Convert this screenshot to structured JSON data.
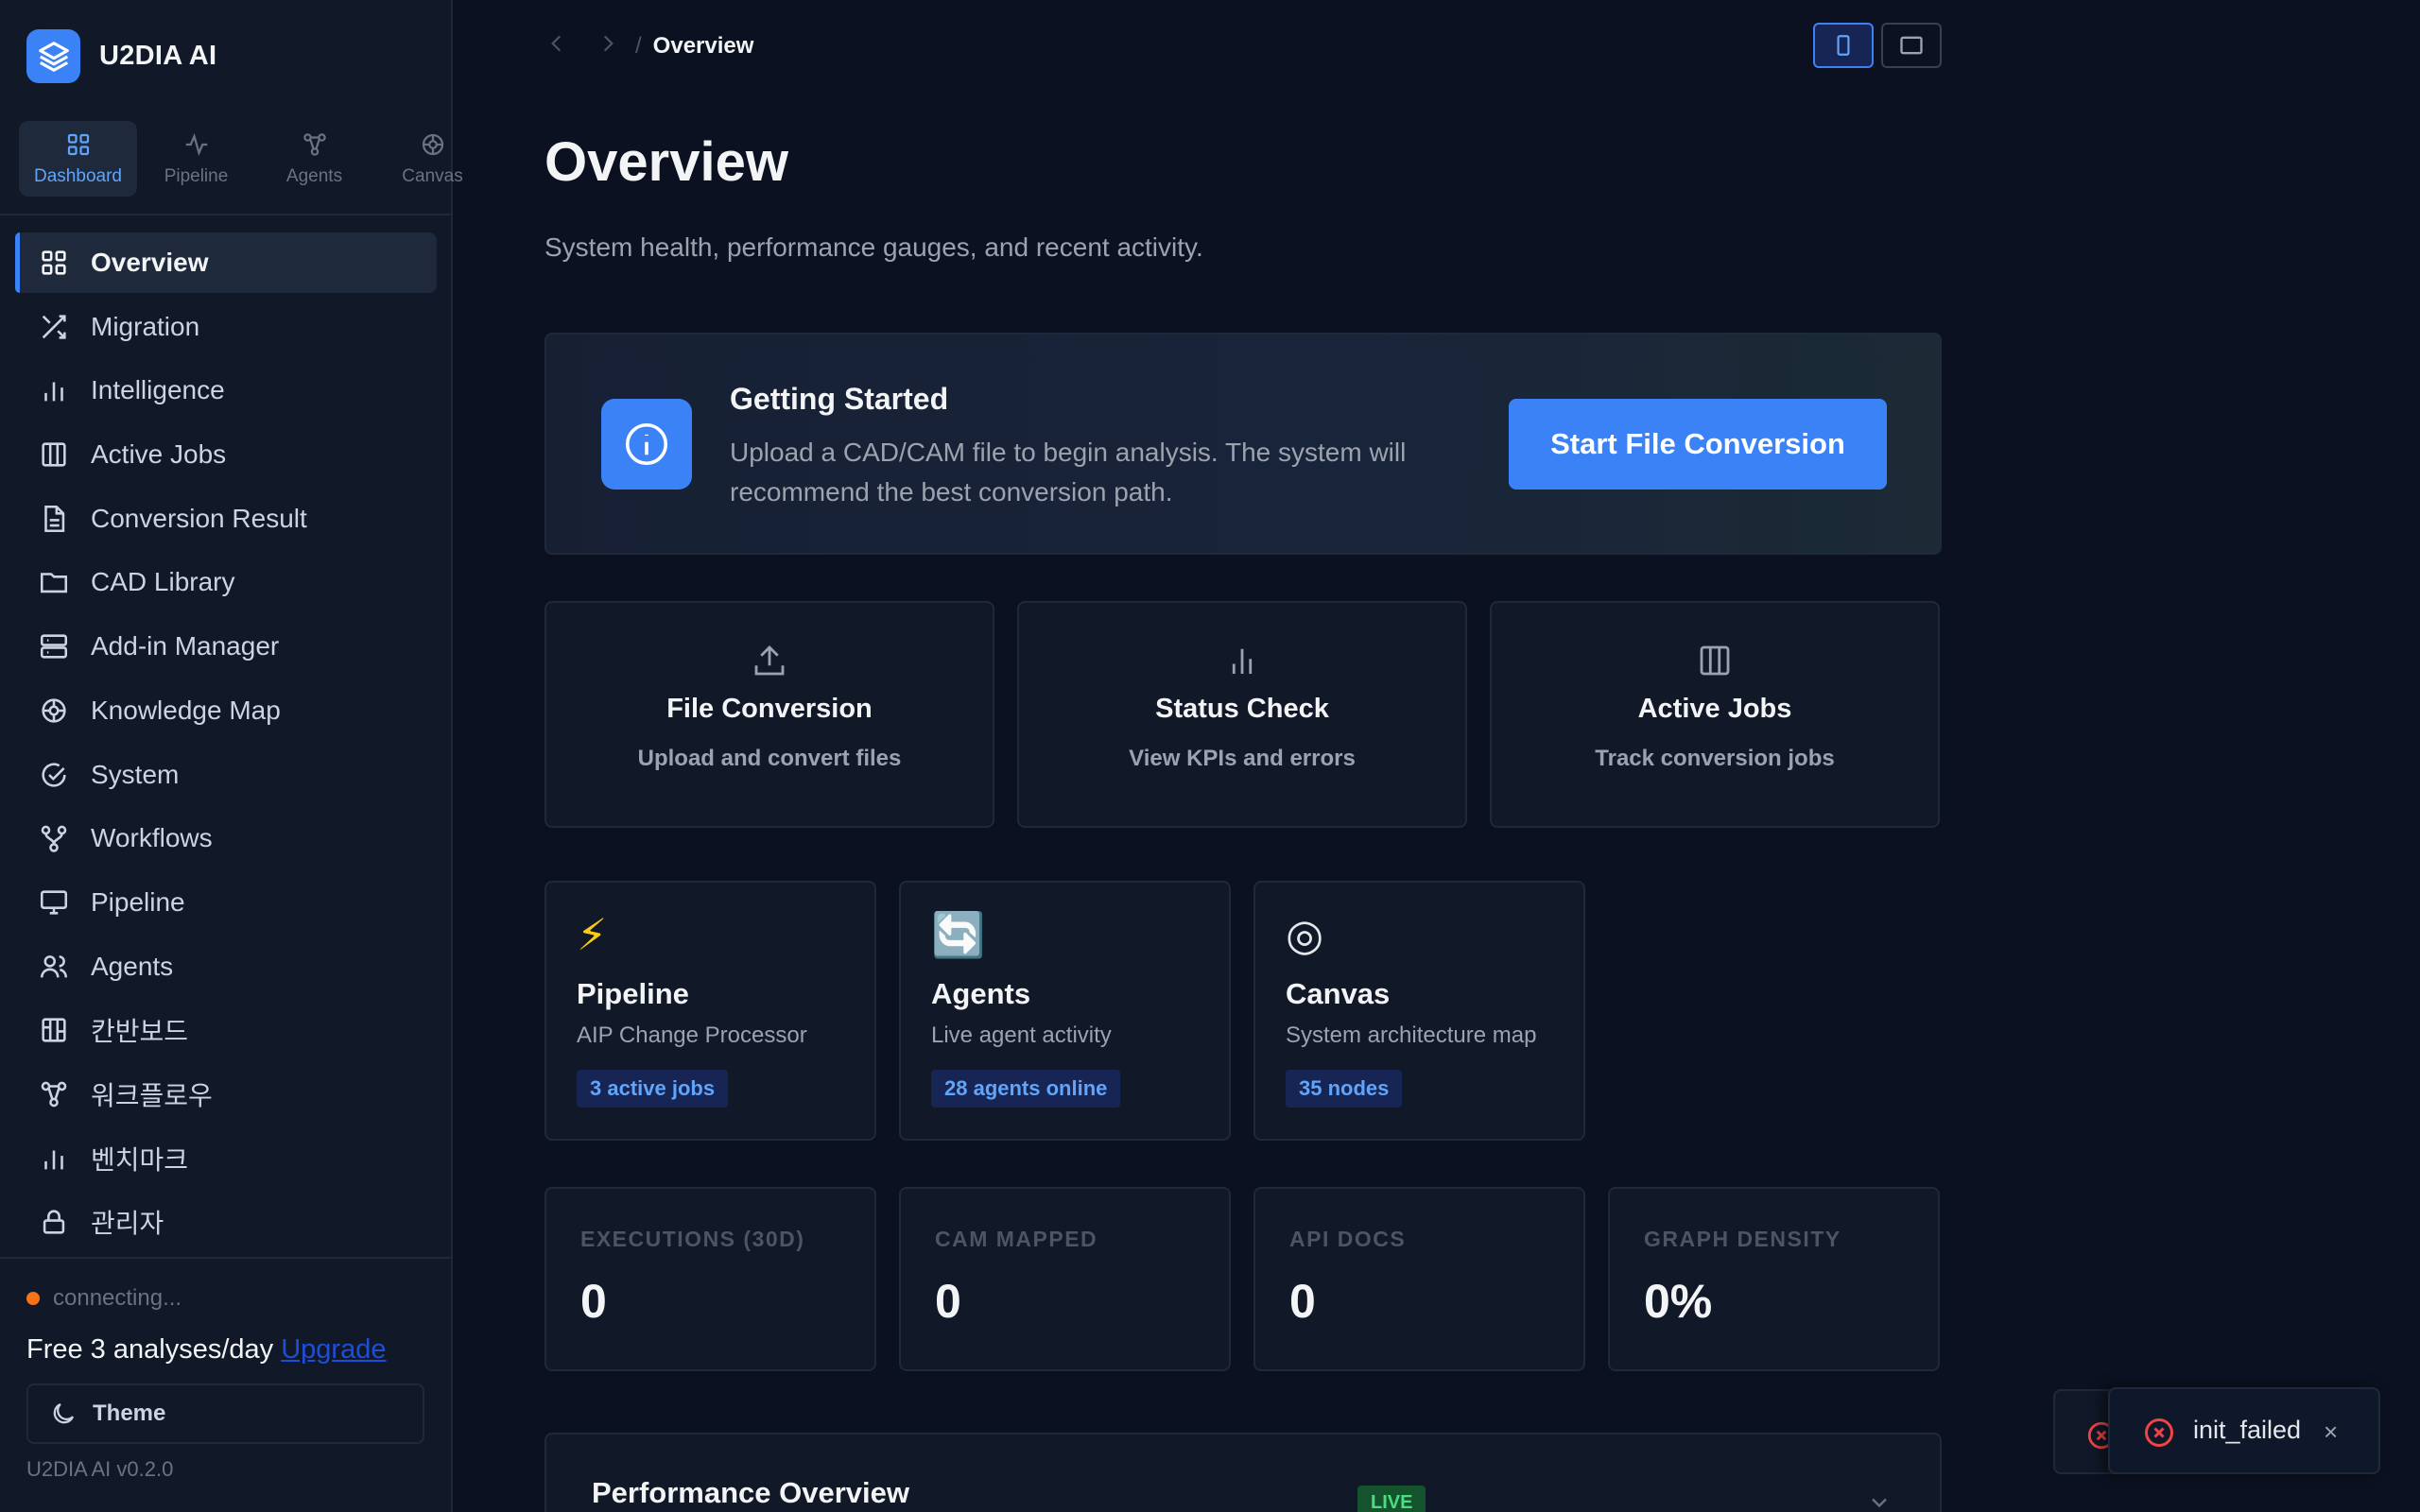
{
  "brand": {
    "name": "U2DIA AI"
  },
  "mode_tabs": [
    {
      "label": "Dashboard",
      "icon": "grid-icon",
      "active": true
    },
    {
      "label": "Pipeline",
      "icon": "activity-icon",
      "active": false
    },
    {
      "label": "Agents",
      "icon": "share-nodes-icon",
      "active": false
    },
    {
      "label": "Canvas",
      "icon": "target-icon",
      "active": false
    }
  ],
  "nav": [
    {
      "label": "Overview",
      "icon": "grid-icon",
      "active": true
    },
    {
      "label": "Migration",
      "icon": "shuffle-icon"
    },
    {
      "label": "Intelligence",
      "icon": "bar-chart-icon"
    },
    {
      "label": "Active Jobs",
      "icon": "columns-icon"
    },
    {
      "label": "Conversion Result",
      "icon": "file-text-icon"
    },
    {
      "label": "CAD Library",
      "icon": "folder-icon"
    },
    {
      "label": "Add-in Manager",
      "icon": "server-icon"
    },
    {
      "label": "Knowledge Map",
      "icon": "target-icon"
    },
    {
      "label": "System",
      "icon": "check-circle-icon"
    },
    {
      "label": "Workflows",
      "icon": "git-branch-icon"
    },
    {
      "label": "Pipeline",
      "icon": "monitor-icon"
    },
    {
      "label": "Agents",
      "icon": "users-icon"
    },
    {
      "label": "칸반보드",
      "icon": "kanban-icon"
    },
    {
      "label": "워크플로우",
      "icon": "share-nodes-icon"
    },
    {
      "label": "벤치마크",
      "icon": "bar-chart-icon"
    },
    {
      "label": "관리자",
      "icon": "lock-icon"
    }
  ],
  "footer": {
    "status": "connecting...",
    "plan_text": "Free 3 analyses/day",
    "upgrade_link": "Upgrade",
    "theme_label": "Theme",
    "version": "U2DIA AI v0.2.0"
  },
  "breadcrumb": {
    "current": "Overview",
    "separator": "/"
  },
  "page": {
    "title": "Overview",
    "subtitle": "System health, performance gauges, and recent activity."
  },
  "getting_started": {
    "title": "Getting Started",
    "description": "Upload a CAD/CAM file to begin analysis. The system will recommend the best conversion path.",
    "button": "Start File Conversion"
  },
  "quick_actions": [
    {
      "title": "File Conversion",
      "subtitle": "Upload and convert files",
      "icon": "upload-icon"
    },
    {
      "title": "Status Check",
      "subtitle": "View KPIs and errors",
      "icon": "bar-chart-icon"
    },
    {
      "title": "Active Jobs",
      "subtitle": "Track conversion jobs",
      "icon": "columns-icon"
    }
  ],
  "modules": [
    {
      "emoji": "⚡",
      "title": "Pipeline",
      "subtitle": "AIP Change Processor",
      "badge": "3 active jobs"
    },
    {
      "emoji": "🔄",
      "title": "Agents",
      "subtitle": "Live agent activity",
      "badge": "28 agents online"
    },
    {
      "emoji": "◎",
      "title": "Canvas",
      "subtitle": "System architecture map",
      "badge": "35 nodes"
    }
  ],
  "kpis": [
    {
      "label": "EXECUTIONS (30D)",
      "value": "0"
    },
    {
      "label": "CAM MAPPED",
      "value": "0"
    },
    {
      "label": "API DOCS",
      "value": "0"
    },
    {
      "label": "GRAPH DENSITY",
      "value": "0%"
    }
  ],
  "performance": {
    "title": "Performance Overview",
    "badge": "LIVE"
  },
  "toast": {
    "message": "init_failed",
    "close": "×"
  },
  "colors": {
    "accent": "#3b82f6",
    "background": "#0b1120",
    "panel": "#111827",
    "error": "#ef4444",
    "live": "#4ade80"
  }
}
